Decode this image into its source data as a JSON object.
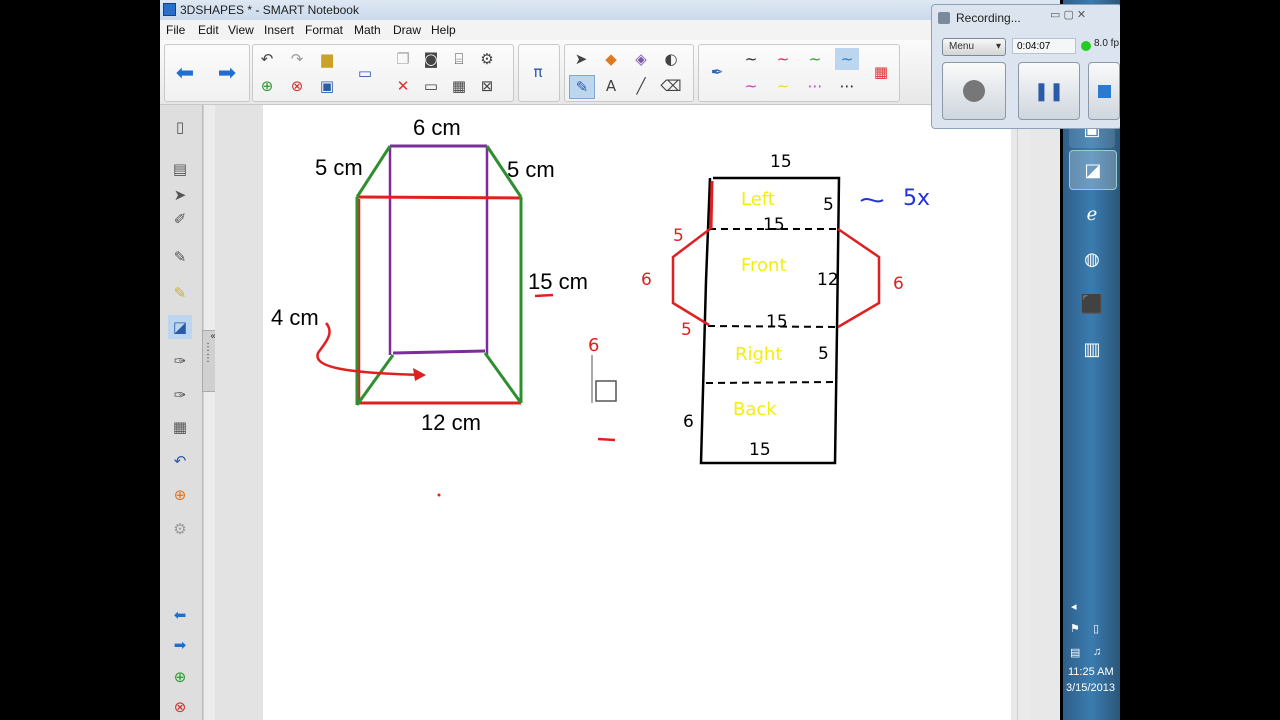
{
  "window": {
    "title": "3DSHAPES * - SMART Notebook"
  },
  "menu": [
    "File",
    "Edit",
    "View",
    "Insert",
    "Format",
    "Math",
    "Draw",
    "Help"
  ],
  "canvas": {
    "prism_labels": {
      "top": "6 cm",
      "left_top": "5 cm",
      "right_top": "5 cm",
      "height": "15 cm",
      "left_side": "4 cm",
      "bottom": "12 cm",
      "inner_six": "6"
    },
    "net": {
      "top_label": "15",
      "left_face": "Left",
      "front_face": "Front",
      "right_face": "Right",
      "back_face": "Back",
      "fifteen_a": "15",
      "fifteen_b": "15",
      "fifteen_c": "15",
      "five_a": "5",
      "five_b": "5",
      "five_left_top": "5",
      "five_left_bot": "5",
      "twelve": "12",
      "six_left": "6",
      "six_right": "6",
      "six_back": "6",
      "note": "5x",
      "arrow": "⤳"
    },
    "colors": {
      "green": "#2f8f2f",
      "red": "#e02020",
      "purple": "#7b2d9a",
      "yellow": "#f5ee0a",
      "blue": "#2233dd"
    }
  },
  "recorder": {
    "title": "Recording...",
    "menu_label": "Menu",
    "time": "0:04:07",
    "fps": "8.0 fp"
  },
  "tray": {
    "time": "11:25 AM",
    "date": "3/15/2013"
  }
}
